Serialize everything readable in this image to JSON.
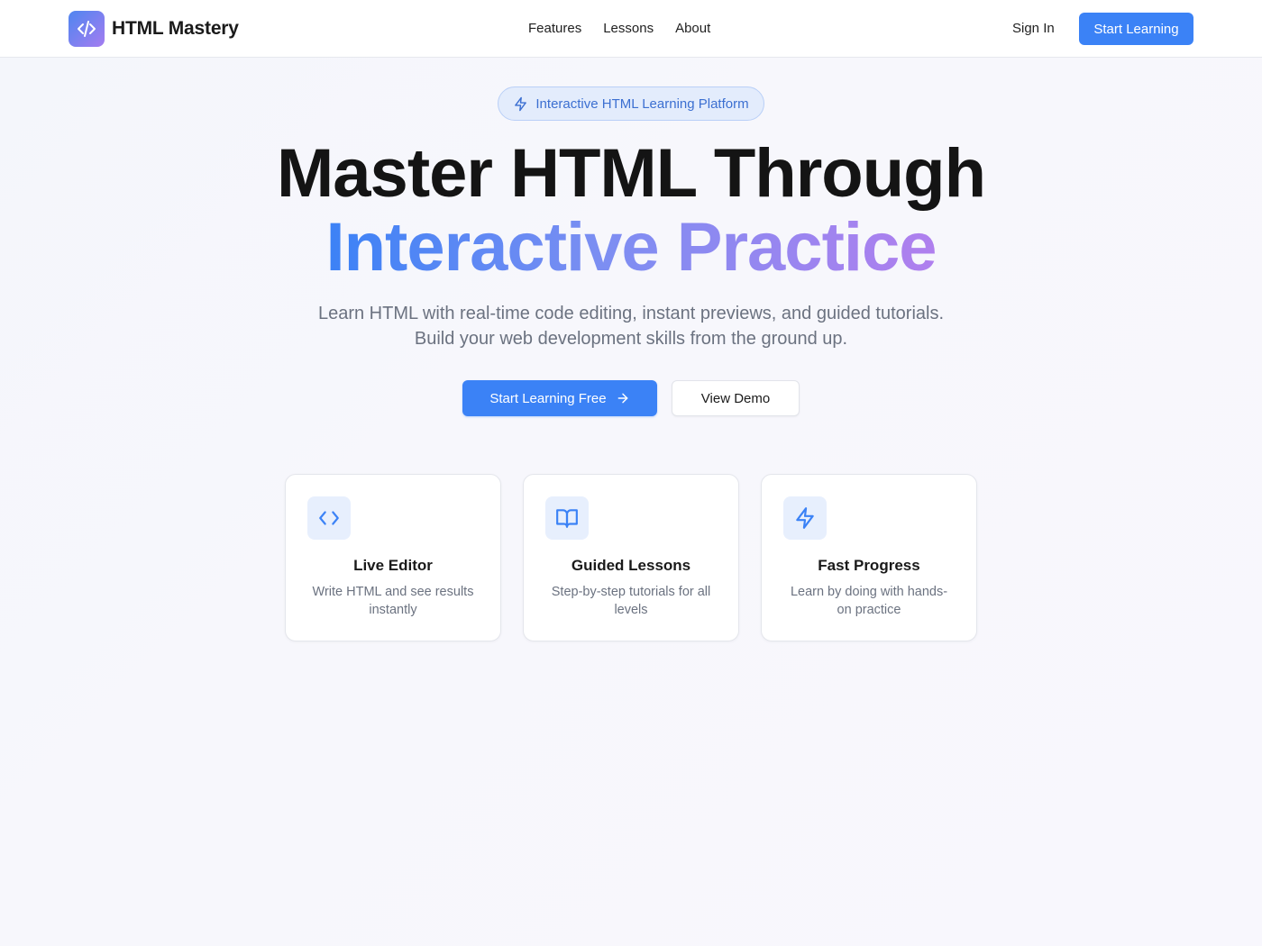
{
  "header": {
    "brand": "HTML Mastery",
    "nav": [
      "Features",
      "Lessons",
      "About"
    ],
    "sign_in": "Sign In",
    "cta": "Start Learning"
  },
  "hero": {
    "badge": "Interactive HTML Learning Platform",
    "title_line1": "Master HTML Through",
    "title_line2": "Interactive Practice",
    "subtitle": "Learn HTML with real-time code editing, instant previews, and guided tutorials. Build your web development skills from the ground up.",
    "primary_button": "Start Learning Free",
    "secondary_button": "View Demo"
  },
  "features": [
    {
      "icon": "code-icon",
      "title": "Live Editor",
      "description": "Write HTML and see results instantly"
    },
    {
      "icon": "book-open-icon",
      "title": "Guided Lessons",
      "description": "Step-by-step tutorials for all levels"
    },
    {
      "icon": "zap-icon",
      "title": "Fast Progress",
      "description": "Learn by doing with hands-on practice"
    }
  ],
  "colors": {
    "primary": "#3b82f6",
    "gradient_start": "#3b82f6",
    "gradient_end": "#b07fee",
    "badge_bg": "#e3ecfc",
    "text_muted": "#6b7280"
  }
}
